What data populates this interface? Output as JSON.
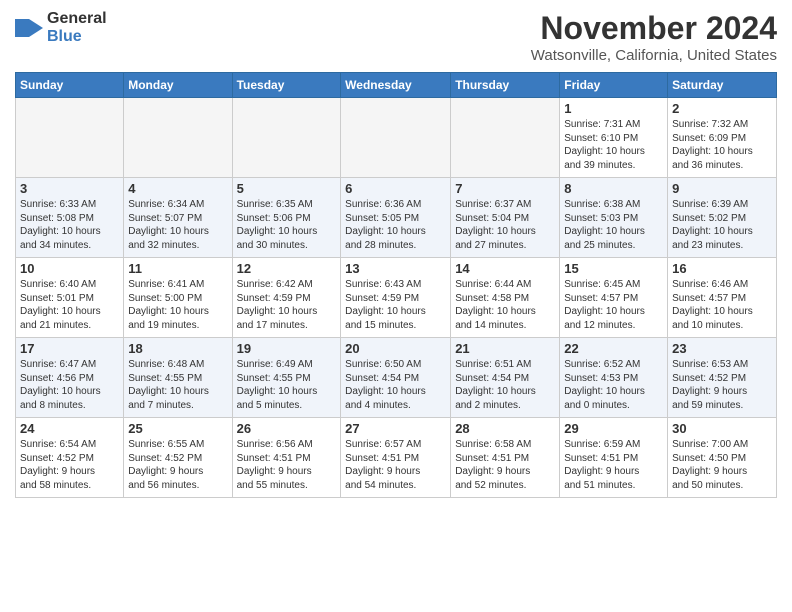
{
  "header": {
    "logo_general": "General",
    "logo_blue": "Blue",
    "month_title": "November 2024",
    "location": "Watsonville, California, United States"
  },
  "calendar": {
    "days_of_week": [
      "Sunday",
      "Monday",
      "Tuesday",
      "Wednesday",
      "Thursday",
      "Friday",
      "Saturday"
    ],
    "weeks": [
      [
        {
          "day": "",
          "info": "",
          "empty": true
        },
        {
          "day": "",
          "info": "",
          "empty": true
        },
        {
          "day": "",
          "info": "",
          "empty": true
        },
        {
          "day": "",
          "info": "",
          "empty": true
        },
        {
          "day": "",
          "info": "",
          "empty": true
        },
        {
          "day": "1",
          "info": "Sunrise: 7:31 AM\nSunset: 6:10 PM\nDaylight: 10 hours\nand 39 minutes."
        },
        {
          "day": "2",
          "info": "Sunrise: 7:32 AM\nSunset: 6:09 PM\nDaylight: 10 hours\nand 36 minutes."
        }
      ],
      [
        {
          "day": "3",
          "info": "Sunrise: 6:33 AM\nSunset: 5:08 PM\nDaylight: 10 hours\nand 34 minutes."
        },
        {
          "day": "4",
          "info": "Sunrise: 6:34 AM\nSunset: 5:07 PM\nDaylight: 10 hours\nand 32 minutes."
        },
        {
          "day": "5",
          "info": "Sunrise: 6:35 AM\nSunset: 5:06 PM\nDaylight: 10 hours\nand 30 minutes."
        },
        {
          "day": "6",
          "info": "Sunrise: 6:36 AM\nSunset: 5:05 PM\nDaylight: 10 hours\nand 28 minutes."
        },
        {
          "day": "7",
          "info": "Sunrise: 6:37 AM\nSunset: 5:04 PM\nDaylight: 10 hours\nand 27 minutes."
        },
        {
          "day": "8",
          "info": "Sunrise: 6:38 AM\nSunset: 5:03 PM\nDaylight: 10 hours\nand 25 minutes."
        },
        {
          "day": "9",
          "info": "Sunrise: 6:39 AM\nSunset: 5:02 PM\nDaylight: 10 hours\nand 23 minutes."
        }
      ],
      [
        {
          "day": "10",
          "info": "Sunrise: 6:40 AM\nSunset: 5:01 PM\nDaylight: 10 hours\nand 21 minutes."
        },
        {
          "day": "11",
          "info": "Sunrise: 6:41 AM\nSunset: 5:00 PM\nDaylight: 10 hours\nand 19 minutes."
        },
        {
          "day": "12",
          "info": "Sunrise: 6:42 AM\nSunset: 4:59 PM\nDaylight: 10 hours\nand 17 minutes."
        },
        {
          "day": "13",
          "info": "Sunrise: 6:43 AM\nSunset: 4:59 PM\nDaylight: 10 hours\nand 15 minutes."
        },
        {
          "day": "14",
          "info": "Sunrise: 6:44 AM\nSunset: 4:58 PM\nDaylight: 10 hours\nand 14 minutes."
        },
        {
          "day": "15",
          "info": "Sunrise: 6:45 AM\nSunset: 4:57 PM\nDaylight: 10 hours\nand 12 minutes."
        },
        {
          "day": "16",
          "info": "Sunrise: 6:46 AM\nSunset: 4:57 PM\nDaylight: 10 hours\nand 10 minutes."
        }
      ],
      [
        {
          "day": "17",
          "info": "Sunrise: 6:47 AM\nSunset: 4:56 PM\nDaylight: 10 hours\nand 8 minutes."
        },
        {
          "day": "18",
          "info": "Sunrise: 6:48 AM\nSunset: 4:55 PM\nDaylight: 10 hours\nand 7 minutes."
        },
        {
          "day": "19",
          "info": "Sunrise: 6:49 AM\nSunset: 4:55 PM\nDaylight: 10 hours\nand 5 minutes."
        },
        {
          "day": "20",
          "info": "Sunrise: 6:50 AM\nSunset: 4:54 PM\nDaylight: 10 hours\nand 4 minutes."
        },
        {
          "day": "21",
          "info": "Sunrise: 6:51 AM\nSunset: 4:54 PM\nDaylight: 10 hours\nand 2 minutes."
        },
        {
          "day": "22",
          "info": "Sunrise: 6:52 AM\nSunset: 4:53 PM\nDaylight: 10 hours\nand 0 minutes."
        },
        {
          "day": "23",
          "info": "Sunrise: 6:53 AM\nSunset: 4:52 PM\nDaylight: 9 hours\nand 59 minutes."
        }
      ],
      [
        {
          "day": "24",
          "info": "Sunrise: 6:54 AM\nSunset: 4:52 PM\nDaylight: 9 hours\nand 58 minutes."
        },
        {
          "day": "25",
          "info": "Sunrise: 6:55 AM\nSunset: 4:52 PM\nDaylight: 9 hours\nand 56 minutes."
        },
        {
          "day": "26",
          "info": "Sunrise: 6:56 AM\nSunset: 4:51 PM\nDaylight: 9 hours\nand 55 minutes."
        },
        {
          "day": "27",
          "info": "Sunrise: 6:57 AM\nSunset: 4:51 PM\nDaylight: 9 hours\nand 54 minutes."
        },
        {
          "day": "28",
          "info": "Sunrise: 6:58 AM\nSunset: 4:51 PM\nDaylight: 9 hours\nand 52 minutes."
        },
        {
          "day": "29",
          "info": "Sunrise: 6:59 AM\nSunset: 4:51 PM\nDaylight: 9 hours\nand 51 minutes."
        },
        {
          "day": "30",
          "info": "Sunrise: 7:00 AM\nSunset: 4:50 PM\nDaylight: 9 hours\nand 50 minutes."
        }
      ]
    ]
  }
}
